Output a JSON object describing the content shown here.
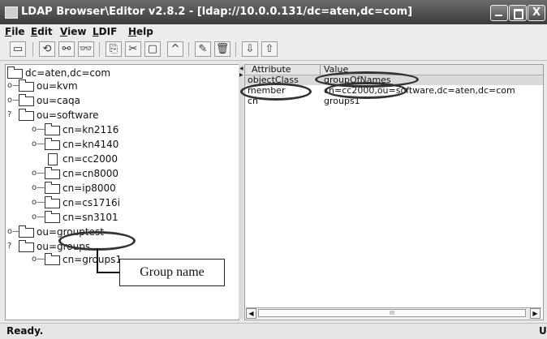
{
  "window": {
    "title": "LDAP Browser\\Editor v2.8.2 - [ldap://10.0.0.131/dc=aten,dc=com]",
    "controls": {
      "minimize": "",
      "maximize": "",
      "close": "X"
    }
  },
  "menu": [
    {
      "mnemonic": "F",
      "rest": "ile"
    },
    {
      "mnemonic": "E",
      "rest": "dit"
    },
    {
      "mnemonic": "V",
      "rest": "iew"
    },
    {
      "mnemonic": "L",
      "rest": "DIF"
    },
    {
      "mnemonic": "H",
      "rest": "elp"
    }
  ],
  "toolbar": {
    "icons": [
      "connect-icon",
      "reconnect-icon",
      "disconnect-icon",
      "search-icon",
      "copy-icon",
      "cut-icon",
      "paste-icon",
      "move-up-icon",
      "edit-icon",
      "delete-icon",
      "export-icon",
      "import-icon"
    ],
    "glyphs": [
      "▭",
      "⟲",
      "⚯",
      "👓",
      "⎘",
      "✂",
      "▢",
      "^",
      "✎",
      "🗑",
      "⇩",
      "⇧"
    ]
  },
  "tree": {
    "root": "dc=aten,dc=com",
    "nodes": [
      "ou=kvm",
      "ou=caqa",
      "ou=software",
      "cn=kn2116",
      "cn=kn4140",
      "cn=cc2000",
      "cn=cn8000",
      "cn=ip8000",
      "cn=cs1716i",
      "cn=sn3101",
      "ou=grouptest",
      "ou=groups",
      "cn=groups1"
    ],
    "toggles": {
      "collapsed": "o—",
      "expanded": "?"
    }
  },
  "attributes": {
    "headers": {
      "attribute": "Attribute",
      "value": "Value"
    },
    "rows": [
      {
        "attribute": "objectClass",
        "value": "groupOfNames"
      },
      {
        "attribute": "member",
        "value": "cn=cc2000,ou=software,dc=aten,dc=com"
      },
      {
        "attribute": "cn",
        "value": "groups1"
      }
    ]
  },
  "scrollbar": {
    "left_arrow": "◀",
    "right_arrow": "▶",
    "thumb": "III"
  },
  "status": {
    "text": "Ready.",
    "right": "U"
  },
  "annotation": {
    "callout": "Group name"
  }
}
